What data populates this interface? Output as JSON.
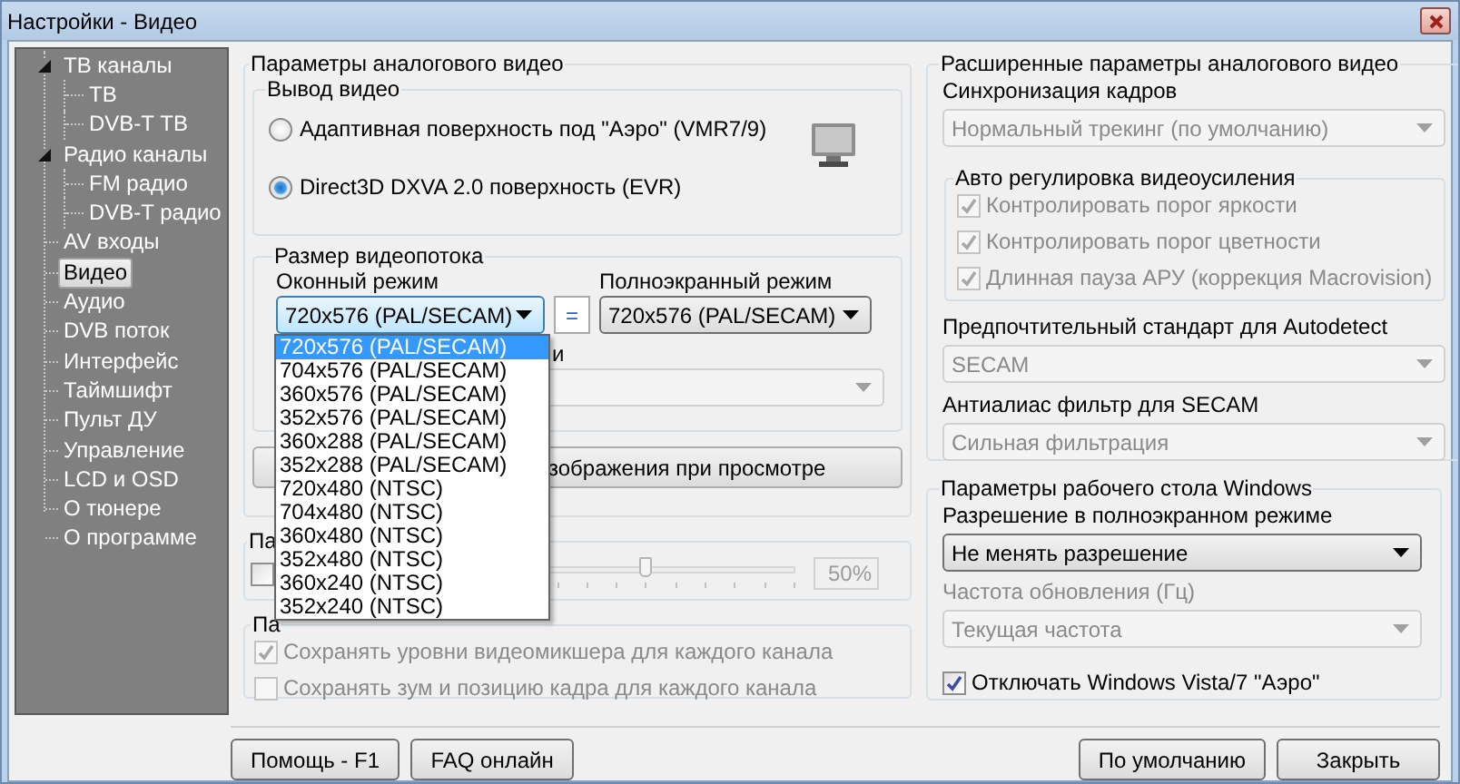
{
  "window": {
    "title": "Настройки - Видео"
  },
  "sidebar": {
    "items": [
      {
        "label": "ТВ каналы",
        "selected": false,
        "expanded": true,
        "children": [
          {
            "label": "ТВ",
            "selected": false
          },
          {
            "label": "DVB-T ТВ",
            "selected": false
          }
        ]
      },
      {
        "label": "Радио каналы",
        "selected": false,
        "expanded": true,
        "children": [
          {
            "label": "FM радио",
            "selected": false
          },
          {
            "label": "DVB-T радио",
            "selected": false
          }
        ]
      },
      {
        "label": "AV входы",
        "selected": false
      },
      {
        "label": "Видео",
        "selected": true
      },
      {
        "label": "Аудио",
        "selected": false
      },
      {
        "label": "DVB поток",
        "selected": false
      },
      {
        "label": "Интерфейс",
        "selected": false
      },
      {
        "label": "Таймшифт",
        "selected": false
      },
      {
        "label": "Пульт ДУ",
        "selected": false
      },
      {
        "label": "Управление",
        "selected": false
      },
      {
        "label": "LCD и OSD",
        "selected": false
      },
      {
        "label": "О тюнере",
        "selected": false
      },
      {
        "label": "О программе",
        "selected": false
      }
    ]
  },
  "analog_video": {
    "title": "Параметры аналогового видео",
    "video_output": {
      "title": "Вывод видео",
      "options": [
        {
          "label": "Адаптивная поверхность под \"Аэро\" (VMR7/9)",
          "selected": false
        },
        {
          "label": "Direct3D DXVA 2.0 поверхность (EVR)",
          "selected": true
        }
      ]
    },
    "stream_size": {
      "title": "Размер видеопотока",
      "windowed": {
        "label": "Оконный режим",
        "value": "720x576 (PAL/SECAM)",
        "expanded": true,
        "options": [
          {
            "label": "720x576 (PAL/SECAM)",
            "selected": true
          },
          {
            "label": "704x576 (PAL/SECAM)",
            "selected": false
          },
          {
            "label": "360x576 (PAL/SECAM)",
            "selected": false
          },
          {
            "label": "352x576 (PAL/SECAM)",
            "selected": false
          },
          {
            "label": "360x288 (PAL/SECAM)",
            "selected": false
          },
          {
            "label": "352x288 (PAL/SECAM)",
            "selected": false
          },
          {
            "label": "720x480 (NTSC)",
            "selected": false
          },
          {
            "label": "704x480 (NTSC)",
            "selected": false
          },
          {
            "label": "360x480 (NTSC)",
            "selected": false
          },
          {
            "label": "352x480 (NTSC)",
            "selected": false
          },
          {
            "label": "360x240 (NTSC)",
            "selected": false
          },
          {
            "label": "352x240 (NTSC)",
            "selected": false
          }
        ]
      },
      "link_button": "=",
      "fullscreen": {
        "label": "Полноэкранный режим",
        "value": "720x576 (PAL/SECAM)"
      },
      "label_3": "и",
      "combo_3": {
        "disabled": true
      }
    },
    "button_label": "зображения при просмотре"
  },
  "group_2": {
    "title": "Па",
    "checkbox": {
      "checked": false
    },
    "slider": {
      "level": 0.5
    },
    "reading": "50%"
  },
  "group_3": {
    "title": "Па",
    "checkboxes": [
      {
        "label": "Сохранять уровни видеомикшера для каждого канала",
        "checked": true,
        "disabled": true
      },
      {
        "label": "Сохранять зум и позицию кадра для каждого канала",
        "checked": false,
        "disabled": true
      }
    ]
  },
  "advanced": {
    "title": "Расширенные параметры аналогового видео",
    "sync": {
      "label": "Синхронизация кадров",
      "value": "Нормальный трекинг (по умолчанию)",
      "disabled": true
    },
    "agc": {
      "title": "Авто регулировка видеоусиления",
      "checkboxes": [
        {
          "label": "Контролировать порог яркости",
          "checked": true,
          "disabled": true
        },
        {
          "label": "Контролировать порог цветности",
          "checked": true,
          "disabled": true
        },
        {
          "label": "Длинная пауза АРУ (коррекция Macrovision)",
          "checked": true,
          "disabled": true
        }
      ]
    },
    "standard": {
      "label": "Предпочтительный стандарт для Autodetect",
      "value": "SECAM",
      "disabled": true
    },
    "antialias": {
      "label": "Антиалиас фильтр для SECAM",
      "value": "Сильная фильтрация",
      "disabled": true
    }
  },
  "desktop": {
    "title": "Параметры рабочего стола Windows",
    "resolution": {
      "label": "Разрешение в полноэкранном режиме",
      "value": "Не менять разрешение",
      "disabled": false
    },
    "refresh": {
      "label": "Частота обновления (Гц)",
      "value": "Текущая частота",
      "disabled": true
    },
    "aero": {
      "label": "Отключать Windows Vista/7 \"Аэро\"",
      "checked": true,
      "disabled": false
    }
  },
  "buttons_left": [
    "Помощь - F1",
    "FAQ онлайн"
  ],
  "buttons_right": [
    "По умолчанию",
    "Закрыть"
  ]
}
